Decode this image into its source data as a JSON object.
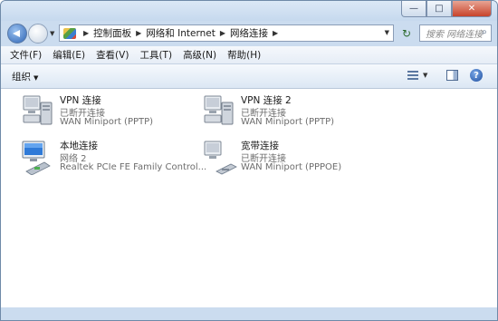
{
  "titlebar": {
    "minimize_glyph": "—",
    "maximize_glyph": "□",
    "close_glyph": "✕"
  },
  "address_bar": {
    "breadcrumbs": [
      "控制面板",
      "网络和 Internet",
      "网络连接"
    ],
    "separator": "▶",
    "refresh_glyph": "↻",
    "search_placeholder": "搜索 网络连接",
    "search_icon": "search-icon"
  },
  "menu": {
    "items": [
      "文件(F)",
      "编辑(E)",
      "查看(V)",
      "工具(T)",
      "高级(N)",
      "帮助(H)"
    ]
  },
  "commandbar": {
    "organize_label": "组织",
    "help_glyph": "?"
  },
  "connections": [
    {
      "name": "VPN 连接",
      "status": "已断开连接",
      "device": "WAN Miniport (PPTP)",
      "icon": "vpn-connection-icon"
    },
    {
      "name": "VPN 连接 2",
      "status": "已断开连接",
      "device": "WAN Miniport (PPTP)",
      "icon": "vpn-connection-icon"
    },
    {
      "name": "本地连接",
      "status": "网络  2",
      "device": "Realtek PCIe FE Family Control...",
      "icon": "local-area-connection-icon"
    },
    {
      "name": "宽带连接",
      "status": "已断开连接",
      "device": "WAN Miniport (PPPOE)",
      "icon": "broadband-connection-icon"
    }
  ],
  "colors": {
    "window_frame": "#cbdcef",
    "close_button": "#c7432b",
    "accent": "#2e64b5"
  }
}
